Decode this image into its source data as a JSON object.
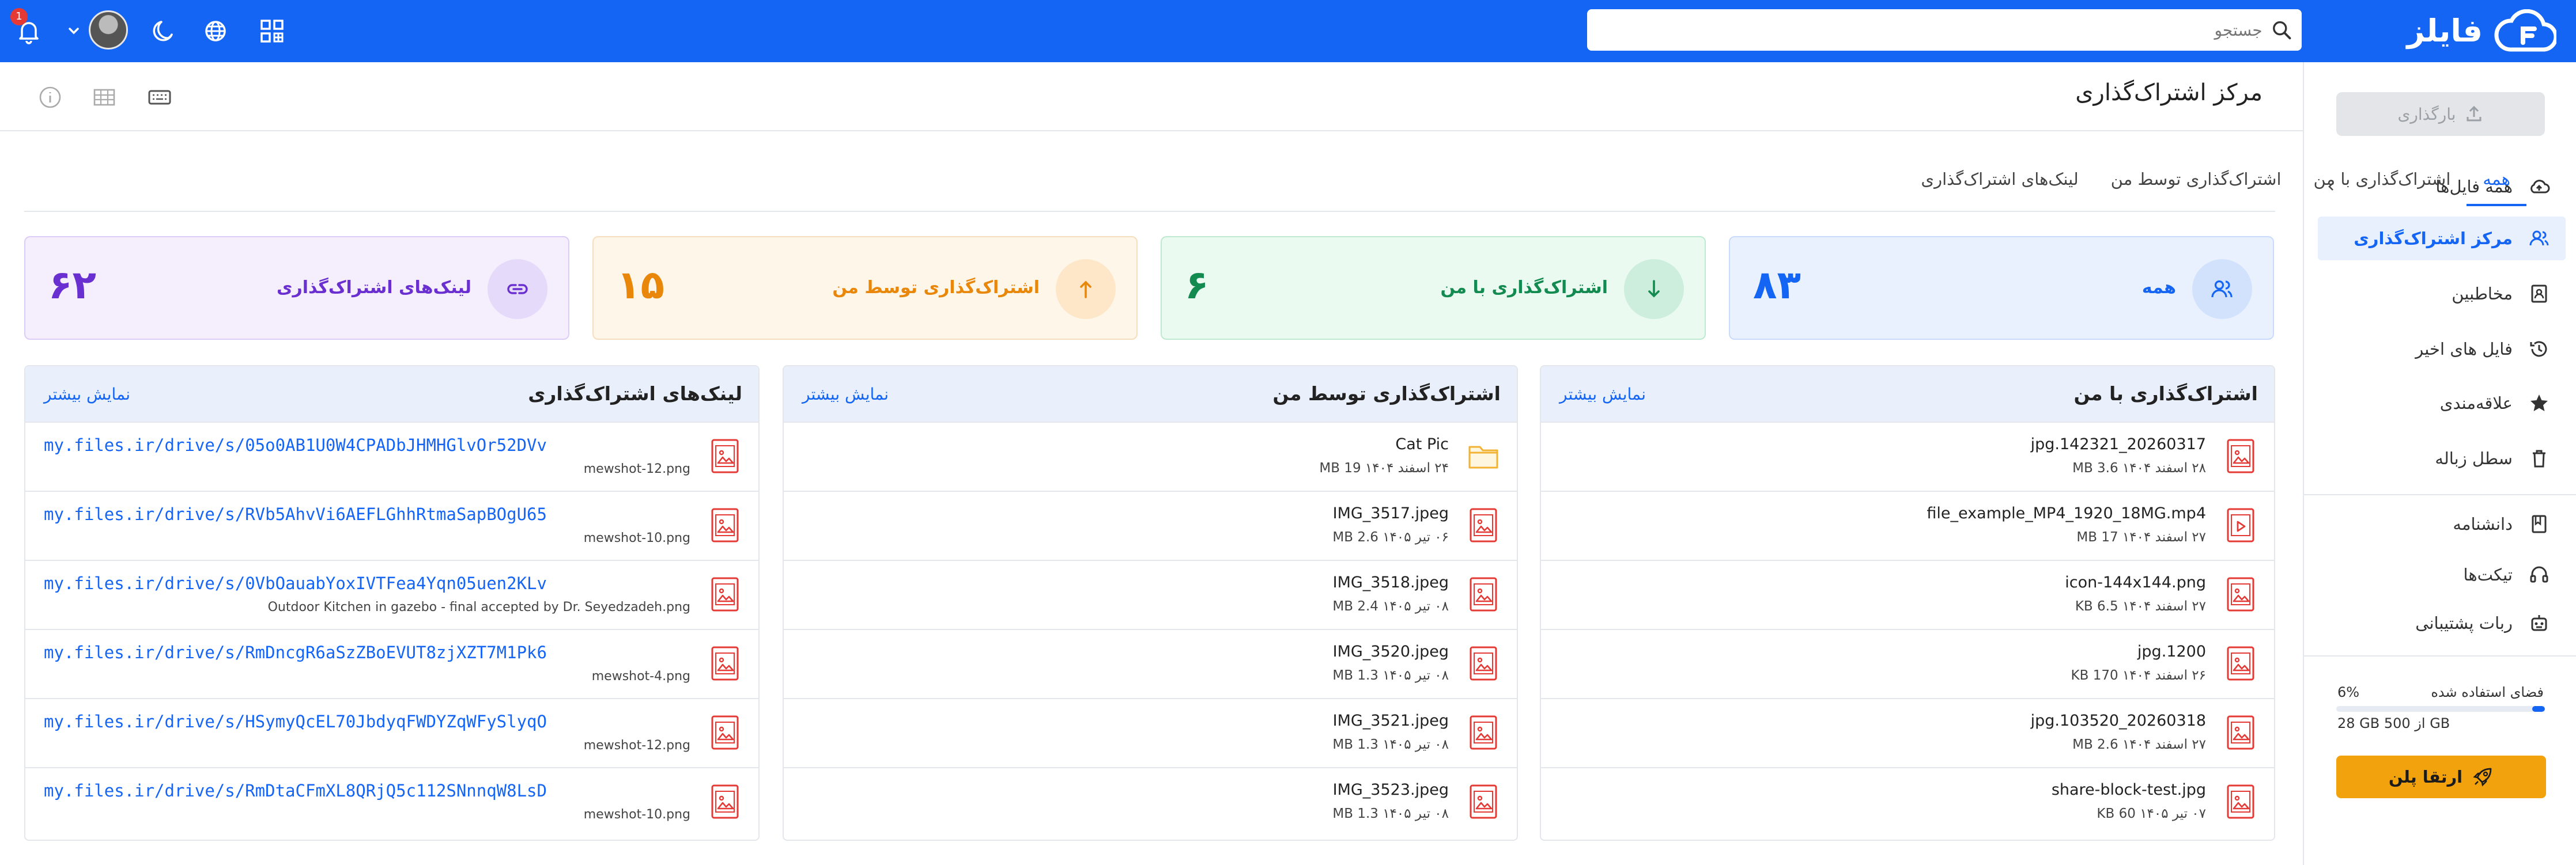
{
  "app": {
    "logo_text": "فایلز"
  },
  "search": {
    "placeholder": "جستجو"
  },
  "notifications": {
    "count": "1"
  },
  "sidebar": {
    "upload_label": "بارگذاری",
    "items": [
      {
        "label": "همه فایل‌ها"
      },
      {
        "label": "مرکز اشتراک‌گذاری"
      },
      {
        "label": "مخاطبین"
      },
      {
        "label": "فایل های اخیر"
      },
      {
        "label": "علاقه‌مندی"
      },
      {
        "label": "سطل زباله"
      },
      {
        "label": "دانشنامه"
      },
      {
        "label": "تیکت‌ها"
      },
      {
        "label": "ربات پشتیبانی"
      }
    ],
    "storage": {
      "label": "فضای استفاده شده",
      "percent": "6%",
      "fraction": 0.06,
      "usage": "28 GB از 500 GB"
    },
    "upgrade_label": "ارتقا پلن"
  },
  "header": {
    "title": "مرکز اشتراک‌گذاری"
  },
  "tabs": [
    {
      "label": "همه"
    },
    {
      "label": "اشتراک‌گذاری با من"
    },
    {
      "label": "اشتراک‌گذاری توسط من"
    },
    {
      "label": "لینک‌های اشتراک‌گذاری"
    }
  ],
  "stats": [
    {
      "label": "همه",
      "value": "۸۳",
      "color": "#1565f5",
      "bg": "#eaf1fe",
      "border": "#c9dbfb",
      "icon_bg": "#d3e2fc"
    },
    {
      "label": "اشتراک‌گذاری با من",
      "value": "۶",
      "color": "#138a4f",
      "bg": "#eafaf1",
      "border": "#bfe9d1",
      "icon_bg": "#cdeedd"
    },
    {
      "label": "اشتراک‌گذاری توسط من",
      "value": "۱۵",
      "color": "#e8870a",
      "bg": "#fff6ea",
      "border": "#f7dfbd",
      "icon_bg": "#fde7c8"
    },
    {
      "label": "لینک‌های اشتراک‌گذاری",
      "value": "۶۲",
      "color": "#6a2fd0",
      "bg": "#f4eefd",
      "border": "#dccdf6",
      "icon_bg": "#e6dafb"
    }
  ],
  "panels": {
    "shared_with_me": {
      "title": "اشتراک‌گذاری با من",
      "more": "نمایش بیشتر",
      "rows": [
        {
          "name": "jpg.142321_20260317",
          "meta": "۲۸ اسفند ۱۴۰۴   3.6 MB",
          "icon": "image-file-icon"
        },
        {
          "name": "file_example_MP4_1920_18MG.mp4",
          "meta": "۲۷ اسفند ۱۴۰۴   17 MB",
          "icon": "video-file-icon"
        },
        {
          "name": "icon-144x144.png",
          "meta": "۲۷ اسفند ۱۴۰۴   6.5 KB",
          "icon": "image-file-icon"
        },
        {
          "name": "jpg.1200",
          "meta": "۲۶ اسفند ۱۴۰۴   170 KB",
          "icon": "image-file-icon"
        },
        {
          "name": "jpg.103520_20260318",
          "meta": "۲۷ اسفند ۱۴۰۴   2.6 MB",
          "icon": "image-file-icon"
        },
        {
          "name": "share-block-test.jpg",
          "meta": "۰۷ تیر ۱۴۰۵   60 KB",
          "icon": "image-file-icon"
        }
      ]
    },
    "shared_by_me": {
      "title": "اشتراک‌گذاری توسط من",
      "more": "نمایش بیشتر",
      "rows": [
        {
          "name": "Cat Pic",
          "meta": "۲۴ اسفند ۱۴۰۴   19 MB",
          "icon": "folder-icon"
        },
        {
          "name": "IMG_3517.jpeg",
          "meta": "۰۶ تیر ۱۴۰۵   2.6 MB",
          "icon": "image-file-icon"
        },
        {
          "name": "IMG_3518.jpeg",
          "meta": "۰۸ تیر ۱۴۰۵   2.4 MB",
          "icon": "image-file-icon"
        },
        {
          "name": "IMG_3520.jpeg",
          "meta": "۰۸ تیر ۱۴۰۵   1.3 MB",
          "icon": "image-file-icon"
        },
        {
          "name": "IMG_3521.jpeg",
          "meta": "۰۸ تیر ۱۴۰۵   1.3 MB",
          "icon": "image-file-icon"
        },
        {
          "name": "IMG_3523.jpeg",
          "meta": "۰۸ تیر ۱۴۰۵   1.3 MB",
          "icon": "image-file-icon"
        }
      ]
    },
    "share_links": {
      "title": "لینک‌های اشتراک‌گذاری",
      "more": "نمایش بیشتر",
      "rows": [
        {
          "url": "my.files.ir/drive/s/05o0AB1U0W4CPADbJHMHGlvOr52DVv",
          "file": "mewshot-12.png"
        },
        {
          "url": "my.files.ir/drive/s/RVb5AhvVi6AEFLGhhRtmaSapBOgU65",
          "file": "mewshot-10.png"
        },
        {
          "url": "my.files.ir/drive/s/0VbOauabYoxIVTFea4Yqn05uen2KLv",
          "file": "Outdoor Kitchen in gazebo - final accepted by Dr. Seyedzadeh.png"
        },
        {
          "url": "my.files.ir/drive/s/RmDncgR6aSzZBoEVUT8zjXZT7M1Pk6",
          "file": "mewshot-4.png"
        },
        {
          "url": "my.files.ir/drive/s/HSymyQcEL70JbdyqFWDYZqWFySlyqO",
          "file": "mewshot-12.png"
        },
        {
          "url": "my.files.ir/drive/s/RmDtaCFmXL8QRjQ5c112SNnnqW8LsD",
          "file": "mewshot-10.png"
        }
      ]
    }
  }
}
